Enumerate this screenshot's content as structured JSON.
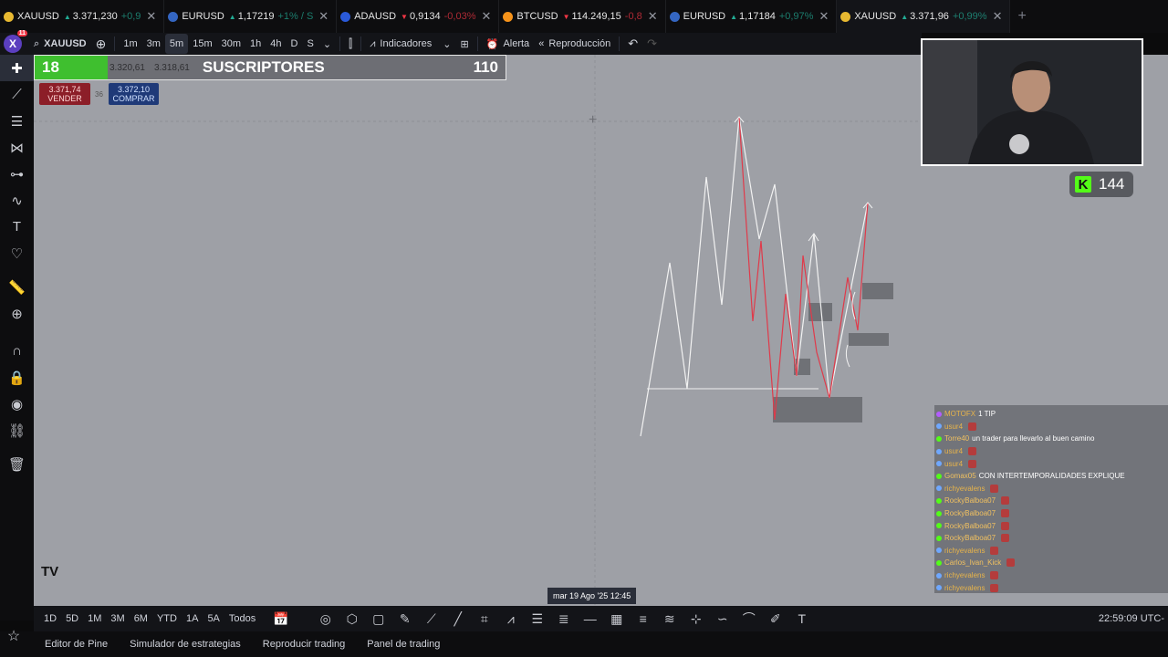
{
  "tabs": [
    {
      "symbol": "XAUUSD",
      "dir": "up",
      "price": "3.371,230",
      "change": "+0,9",
      "dot": "#e8b931"
    },
    {
      "symbol": "EURUSD",
      "dir": "up",
      "price": "1,17219",
      "change": "+1% / S",
      "dot": "#3466c2"
    },
    {
      "symbol": "ADAUSD",
      "dir": "down",
      "price": "0,9134",
      "change": "-0,03%",
      "dot": "#2a5ada"
    },
    {
      "symbol": "BTCUSD",
      "dir": "down",
      "price": "114.249,15",
      "change": "-0,8",
      "dot": "#f7931a"
    },
    {
      "symbol": "EURUSD",
      "dir": "up",
      "price": "1,17184",
      "change": "+0,97%",
      "dot": "#3466c2"
    },
    {
      "symbol": "XAUUSD",
      "dir": "up",
      "price": "3.371,96",
      "change": "+0,99%",
      "dot": "#e8b931"
    }
  ],
  "toolbar": {
    "badge": "11",
    "avatar_letter": "X",
    "symbol": "XAUUSD",
    "intervals": [
      "1m",
      "3m",
      "5m",
      "15m",
      "30m",
      "1h",
      "4h",
      "D",
      "S"
    ],
    "selected_interval": "5m",
    "indicators": "Indicadores",
    "alert": "Alerta",
    "replay": "Reproducción"
  },
  "subs": {
    "count": "18",
    "old1": "3.320,61",
    "old2": "3.318,61",
    "label": "SUSCRIPTORES",
    "goal": "110"
  },
  "trade": {
    "sell_price": "3.371,74",
    "sell_label": "VENDER",
    "spread": "36",
    "buy_price": "3.372,10",
    "buy_label": "COMPRAR"
  },
  "kick": {
    "letter": "K",
    "viewers": "144"
  },
  "chat": [
    {
      "user": "MOTOFX",
      "text": "1 TIP",
      "color": "#b45cff"
    },
    {
      "user": "usur4",
      "text": "",
      "color": "#6fa8ff"
    },
    {
      "user": "Torre40",
      "text": "un trader para llevarlo al buen camino",
      "color": "#53fc18"
    },
    {
      "user": "usur4",
      "text": "",
      "color": "#6fa8ff"
    },
    {
      "user": "usur4",
      "text": "",
      "color": "#6fa8ff"
    },
    {
      "user": "Gomax05",
      "text": "CON INTERTEMPORALIDADES EXPLIQUE",
      "color": "#53fc18"
    },
    {
      "user": "richyevalens",
      "text": "",
      "color": "#6fa8ff"
    },
    {
      "user": "RockyBalboa07",
      "text": "",
      "color": "#53fc18"
    },
    {
      "user": "RockyBalboa07",
      "text": "",
      "color": "#53fc18"
    },
    {
      "user": "RockyBalboa07",
      "text": "",
      "color": "#53fc18"
    },
    {
      "user": "RockyBalboa07",
      "text": "",
      "color": "#53fc18"
    },
    {
      "user": "richyevalens",
      "text": "",
      "color": "#6fa8ff"
    },
    {
      "user": "Carlos_Ivan_Kick",
      "text": "",
      "color": "#53fc18"
    },
    {
      "user": "richyevalens",
      "text": "",
      "color": "#6fa8ff"
    },
    {
      "user": "richyevalens",
      "text": "",
      "color": "#6fa8ff"
    }
  ],
  "timebar": {
    "ranges": [
      "1D",
      "5D",
      "1M",
      "3M",
      "6M",
      "YTD",
      "1A",
      "5A",
      "Todos"
    ],
    "clock": "22:59:09 UTC-",
    "date_tag": "mar 19 Ago '25   12:45"
  },
  "panel": [
    "Editor de Pine",
    "Simulador de estrategias",
    "Reproducir trading",
    "Panel de trading"
  ]
}
